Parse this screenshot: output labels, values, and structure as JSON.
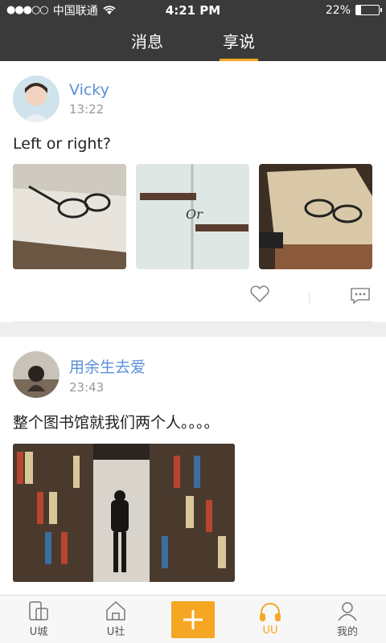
{
  "status": {
    "carrier": "中国联通",
    "time": "4:21 PM",
    "battery": "22%"
  },
  "tabs": [
    {
      "label": "消息"
    },
    {
      "label": "享说"
    }
  ],
  "posts": [
    {
      "user": "Vicky",
      "time": "13:22",
      "text": "Left or right?"
    },
    {
      "user": "用余生去爱",
      "time": "23:43",
      "text": "整个图书馆就我们两个人。。。。"
    }
  ],
  "bottom_tabs": [
    {
      "label": "U城",
      "icon": "phone-app-icon"
    },
    {
      "label": "U社",
      "icon": "house-icon"
    },
    {
      "label": "",
      "icon": "plus-icon"
    },
    {
      "label": "UU",
      "icon": "headphones-icon"
    },
    {
      "label": "我的",
      "icon": "user-icon"
    }
  ],
  "colors": {
    "accent": "#f5a623",
    "topbar": "#3a3a3a",
    "username": "#5b8fd9"
  }
}
